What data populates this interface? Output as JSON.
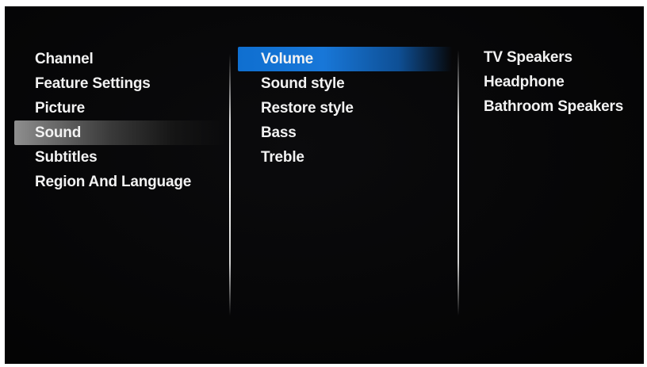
{
  "menu": {
    "left_items": [
      {
        "label": "Channel"
      },
      {
        "label": "Feature Settings"
      },
      {
        "label": "Picture"
      },
      {
        "label": "Sound",
        "selected": true
      },
      {
        "label": "Subtitles"
      },
      {
        "label": "Region And Language"
      }
    ],
    "middle_items": [
      {
        "label": "Volume",
        "focused": true
      },
      {
        "label": "Sound style"
      },
      {
        "label": "Restore style"
      },
      {
        "label": "Bass"
      },
      {
        "label": "Treble"
      }
    ],
    "right_items": [
      {
        "label": "TV Speakers"
      },
      {
        "label": "Headphone"
      },
      {
        "label": "Bathroom Speakers"
      }
    ]
  },
  "colors": {
    "background": "#050506",
    "text": "#f2f2f2",
    "focus_blue": "#1877d8",
    "selected_gray": "#6b6b6b"
  }
}
